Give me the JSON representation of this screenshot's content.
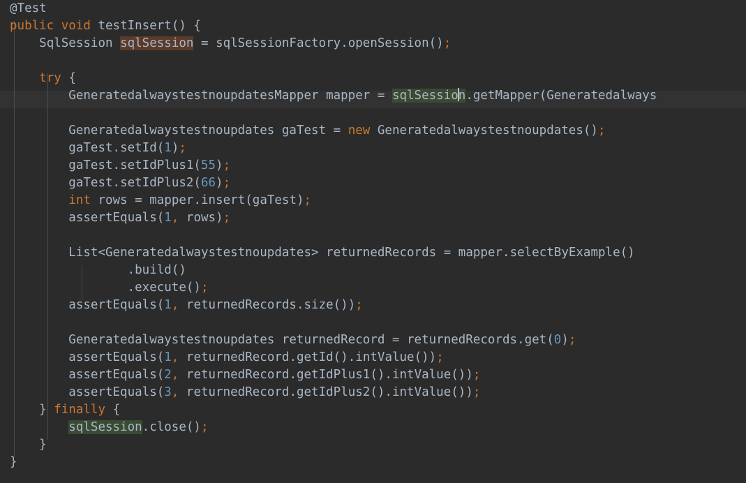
{
  "editor": {
    "app": "code-editor",
    "theme": "darcula",
    "background_color": "#2b2b2b",
    "current_line_color": "#323232",
    "font_size_px": 17.5,
    "line_height_px": 25,
    "caret_line_index": 5,
    "caret_column_token": "sqlSession",
    "colors": {
      "default_text": "#a9b7c6",
      "keyword": "#cc7832",
      "number": "#6897bb",
      "semicolon": "#cc7832",
      "indent_guide": "#4b4b4b",
      "write_occurrence_highlight": "#5a3b2a",
      "read_occurrence_highlight": "#3a4a33",
      "caret": "#bbbbbb"
    },
    "lines": [
      "@Test",
      "public void testInsert() {",
      "    SqlSession sqlSession = sqlSessionFactory.openSession();",
      "",
      "    try {",
      "        GeneratedalwaystestnoupdatesMapper mapper = sqlSession.getMapper(Generatedalways",
      "",
      "        Generatedalwaystestnoupdates gaTest = new Generatedalwaystestnoupdates();",
      "        gaTest.setId(1);",
      "        gaTest.setIdPlus1(55);",
      "        gaTest.setIdPlus2(66);",
      "        int rows = mapper.insert(gaTest);",
      "        assertEquals(1, rows);",
      "",
      "        List<Generatedalwaystestnoupdates> returnedRecords = mapper.selectByExample()",
      "                .build()",
      "                .execute();",
      "        assertEquals(1, returnedRecords.size());",
      "",
      "        Generatedalwaystestnoupdates returnedRecord = returnedRecords.get(0);",
      "        assertEquals(1, returnedRecord.getId().intValue());",
      "        assertEquals(2, returnedRecord.getIdPlus1().intValue());",
      "        assertEquals(3, returnedRecord.getIdPlus2().intValue());",
      "    } finally {",
      "        sqlSession.close();",
      "    }",
      "}"
    ],
    "tokens": {
      "annotation_test": "@Test",
      "kw_public": "public",
      "kw_void": "void",
      "kw_try": "try",
      "kw_new": "new",
      "kw_int": "int",
      "kw_finally": "finally",
      "type_sqlsession": "SqlSession",
      "var_sqlsession": "sqlSession",
      "method_testinsert": "testInsert",
      "var_sqlsessionfactory": "sqlSessionFactory",
      "method_opensession": "openSession",
      "type_mapper": "GeneratedalwaystestnoupdatesMapper",
      "var_mapper": "mapper",
      "method_getmapper": "getMapper",
      "type_entity": "Generatedalwaystestnoupdates",
      "var_gatest": "gaTest",
      "method_setid": "setId",
      "method_setidplus1": "setIdPlus1",
      "method_setidplus2": "setIdPlus2",
      "var_rows": "rows",
      "method_insert": "insert",
      "method_assertequals": "assertEquals",
      "type_list": "List",
      "var_returnedrecords": "returnedRecords",
      "method_selectbyexample": "selectByExample",
      "method_build": "build",
      "method_execute": "execute",
      "method_size": "size",
      "var_returnedrecord": "returnedRecord",
      "method_get": "get",
      "method_getid": "getId",
      "method_getidplus1": "getIdPlus1",
      "method_getidplus2": "getIdPlus2",
      "method_intvalue": "intValue",
      "method_close": "close",
      "num_0": "0",
      "num_1": "1",
      "num_2": "2",
      "num_3": "3",
      "num_55": "55",
      "num_66": "66"
    }
  }
}
